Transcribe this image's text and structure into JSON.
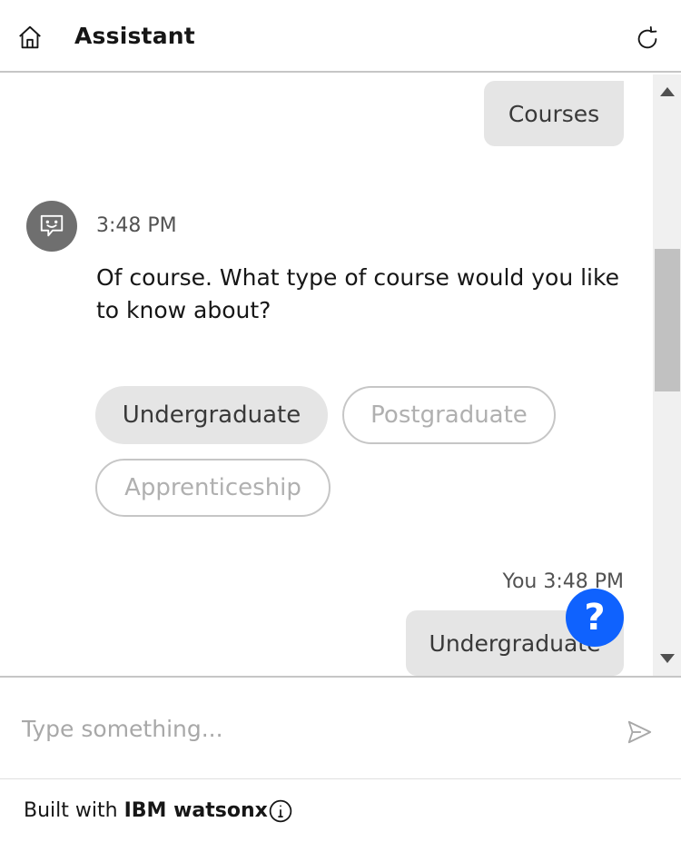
{
  "header": {
    "title": "Assistant",
    "home_icon": "home-icon",
    "restart_icon": "restart-icon"
  },
  "messages": {
    "user_1": {
      "text": "Courses"
    },
    "bot": {
      "time": "3:48 PM",
      "text": "Of course. What type of course would you like to know about?",
      "avatar_icon": "chat-bot-icon",
      "options": [
        {
          "label": "Undergraduate",
          "state": "selected"
        },
        {
          "label": "Postgraduate",
          "state": "disabled"
        },
        {
          "label": "Apprenticeship",
          "state": "disabled"
        }
      ]
    },
    "user_2": {
      "meta": "You 3:48 PM",
      "text": "Undergraduate"
    }
  },
  "help_button": {
    "label": "?"
  },
  "input": {
    "placeholder": "Type something...",
    "value": "",
    "send_icon": "send-icon"
  },
  "footer": {
    "prefix": "Built with",
    "brand": "IBM watsonx",
    "info_icon": "info-icon"
  },
  "colors": {
    "accent": "#0f62fe",
    "bubble": "#e5e5e5",
    "avatar": "#6f6f6f",
    "border": "#c6c6c6"
  }
}
